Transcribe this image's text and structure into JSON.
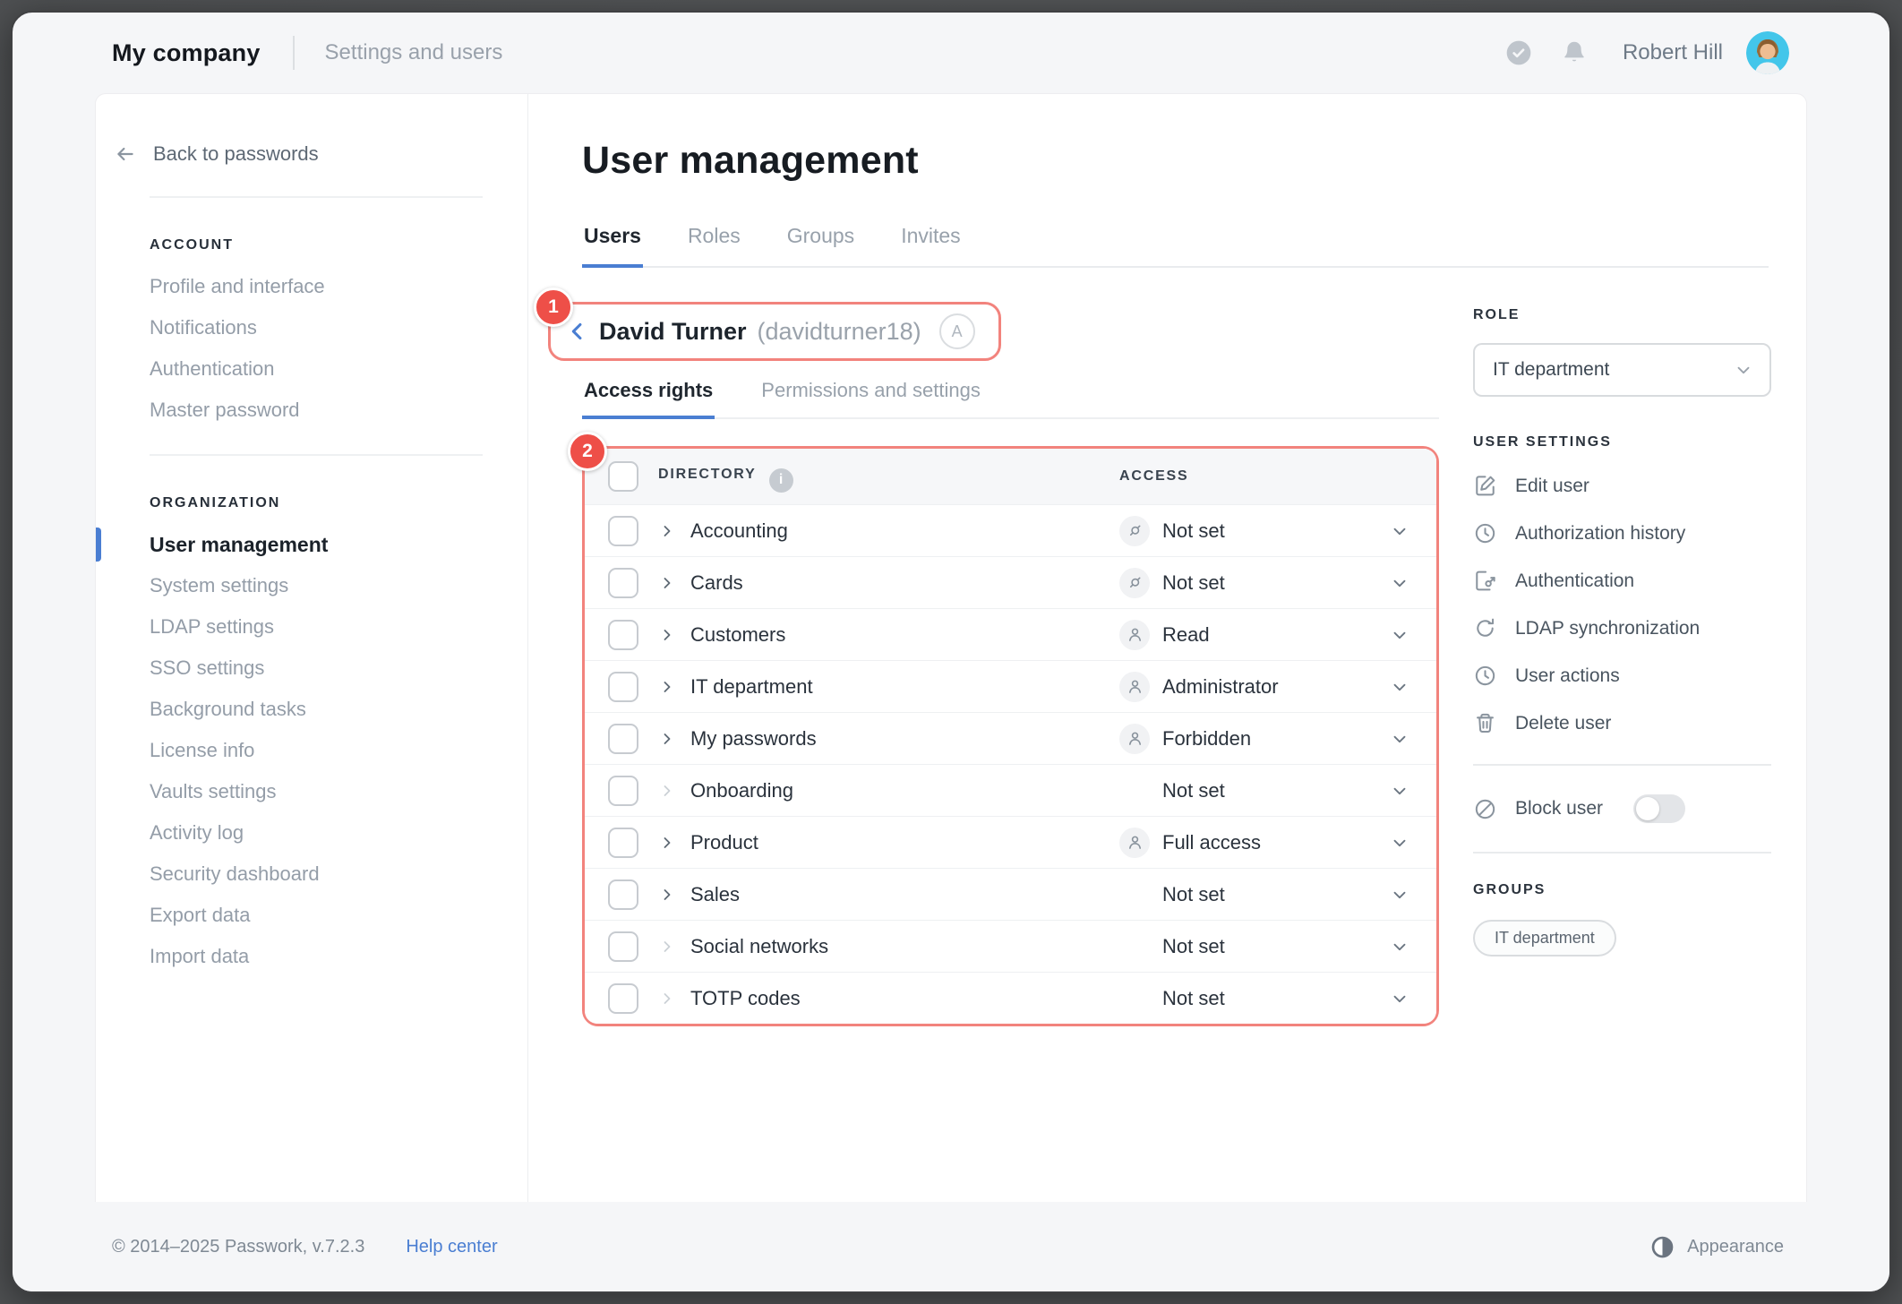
{
  "colors": {
    "accent_blue": "#4a7ed2",
    "annotation_red": "#ee4f48",
    "annotation_border": "#f2837d",
    "avatar_bg": "#43c6ea",
    "page_bg": "#f5f6f8"
  },
  "topbar": {
    "company": "My company",
    "section": "Settings and users",
    "user_name": "Robert Hill"
  },
  "sidebar": {
    "back_label": "Back to passwords",
    "account": {
      "heading": "ACCOUNT",
      "items": [
        {
          "label": "Profile and interface",
          "active": false
        },
        {
          "label": "Notifications",
          "active": false
        },
        {
          "label": "Authentication",
          "active": false
        },
        {
          "label": "Master password",
          "active": false
        }
      ]
    },
    "organization": {
      "heading": "ORGANIZATION",
      "items": [
        {
          "label": "User management",
          "active": true
        },
        {
          "label": "System settings",
          "active": false
        },
        {
          "label": "LDAP settings",
          "active": false
        },
        {
          "label": "SSO settings",
          "active": false
        },
        {
          "label": "Background tasks",
          "active": false
        },
        {
          "label": "License info",
          "active": false
        },
        {
          "label": "Vaults settings",
          "active": false
        },
        {
          "label": "Activity log",
          "active": false
        },
        {
          "label": "Security dashboard",
          "active": false
        },
        {
          "label": "Export data",
          "active": false
        },
        {
          "label": "Import data",
          "active": false
        }
      ]
    }
  },
  "main": {
    "title": "User management",
    "tabs": [
      {
        "label": "Users",
        "active": true
      },
      {
        "label": "Roles",
        "active": false
      },
      {
        "label": "Groups",
        "active": false
      },
      {
        "label": "Invites",
        "active": false
      }
    ],
    "user_header": {
      "annotation": "1",
      "name": "David Turner",
      "login": "(davidturner18)",
      "admin_badge": "A"
    },
    "subtabs": [
      {
        "label": "Access rights",
        "active": true
      },
      {
        "label": "Permissions and settings",
        "active": false
      }
    ],
    "table": {
      "annotation": "2",
      "col_directory": "DIRECTORY",
      "col_access": "ACCESS",
      "info_glyph": "i",
      "rows": [
        {
          "name": "Accounting",
          "access": "Not set",
          "icon": "link",
          "muted": false
        },
        {
          "name": "Cards",
          "access": "Not set",
          "icon": "link",
          "muted": false
        },
        {
          "name": "Customers",
          "access": "Read",
          "icon": "person",
          "muted": false
        },
        {
          "name": "IT department",
          "access": "Administrator",
          "icon": "person",
          "muted": false
        },
        {
          "name": "My passwords",
          "access": "Forbidden",
          "icon": "person",
          "muted": false
        },
        {
          "name": "Onboarding",
          "access": "Not set",
          "icon": "none",
          "muted": true
        },
        {
          "name": "Product",
          "access": "Full access",
          "icon": "person",
          "muted": false
        },
        {
          "name": "Sales",
          "access": "Not set",
          "icon": "none",
          "muted": false
        },
        {
          "name": "Social networks",
          "access": "Not set",
          "icon": "none",
          "muted": true
        },
        {
          "name": "TOTP codes",
          "access": "Not set",
          "icon": "none",
          "muted": true
        }
      ]
    }
  },
  "panel": {
    "role_heading": "ROLE",
    "role_value": "IT department",
    "settings_heading": "USER SETTINGS",
    "actions": [
      {
        "label": "Edit user",
        "icon": "edit-icon"
      },
      {
        "label": "Authorization history",
        "icon": "clock-icon"
      },
      {
        "label": "Authentication",
        "icon": "key-card-icon"
      },
      {
        "label": "LDAP synchronization",
        "icon": "sync-icon"
      },
      {
        "label": "User actions",
        "icon": "clock-icon"
      },
      {
        "label": "Delete user",
        "icon": "trash-icon"
      }
    ],
    "block": {
      "label": "Block user",
      "enabled": false
    },
    "groups_heading": "GROUPS",
    "groups": [
      "IT department"
    ]
  },
  "footer": {
    "copyright": "© 2014–2025 Passwork, v.7.2.3",
    "help": "Help center",
    "appearance": "Appearance"
  }
}
